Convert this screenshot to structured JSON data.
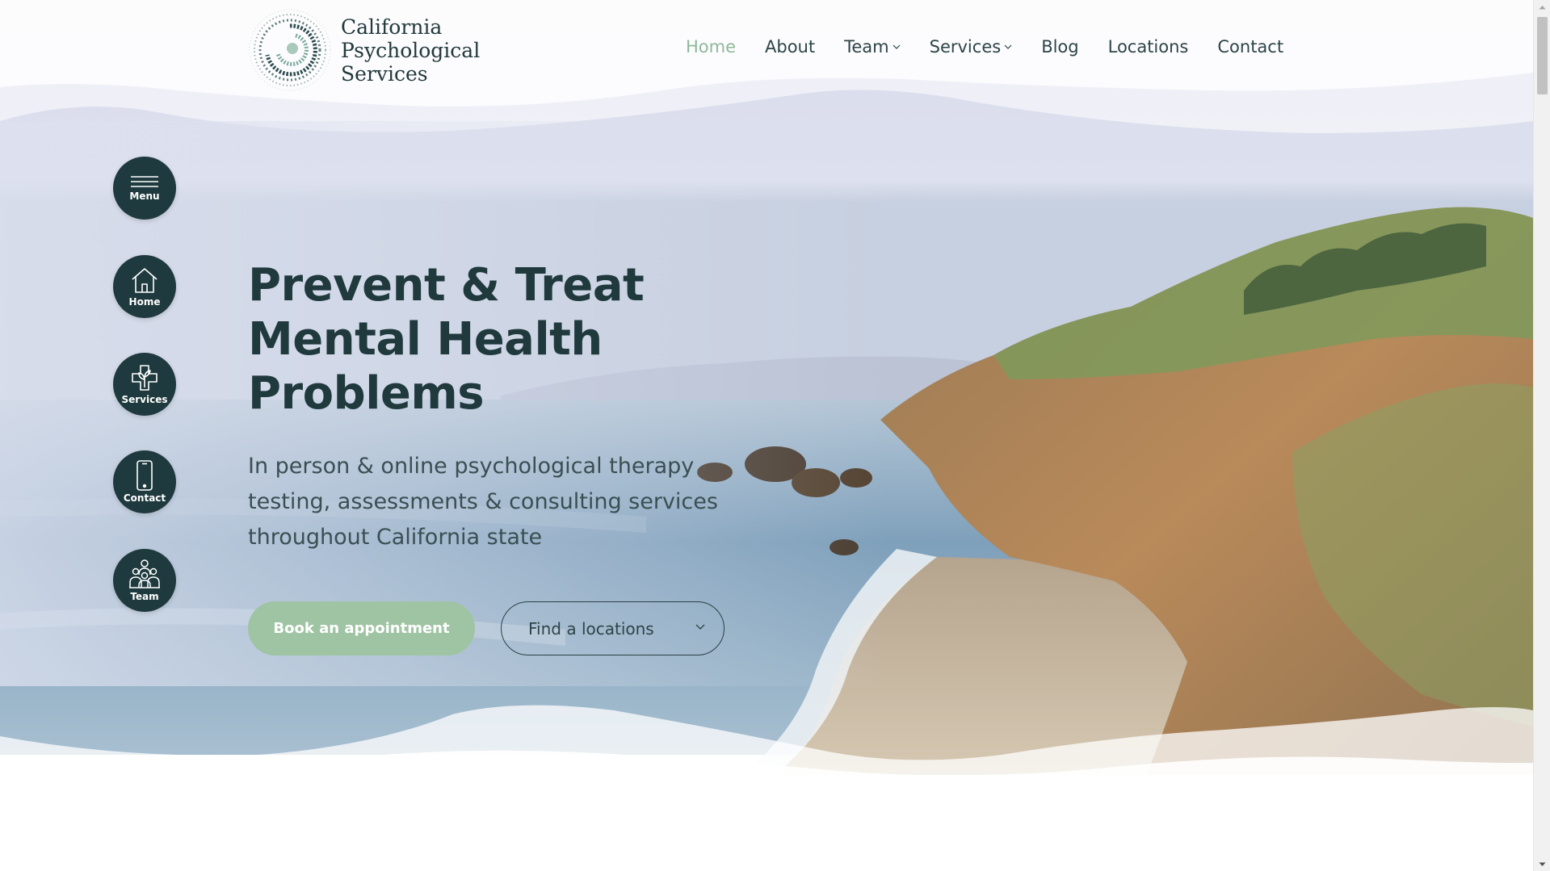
{
  "brand": {
    "name_line1": "California",
    "name_line2": "Psychological",
    "name_line3": "Services",
    "logo_icon": "spiral-dots-logo"
  },
  "nav": {
    "items": [
      {
        "label": "Home",
        "active": true
      },
      {
        "label": "About",
        "active": false
      },
      {
        "label": "Team",
        "dropdown": true
      },
      {
        "label": "Services",
        "dropdown": true
      },
      {
        "label": "Blog",
        "active": false
      },
      {
        "label": "Locations",
        "active": false
      },
      {
        "label": "Contact",
        "active": false
      }
    ]
  },
  "side_nav": {
    "items": [
      {
        "label": "Menu",
        "icon": "hamburger-icon"
      },
      {
        "label": "Home",
        "icon": "house-icon"
      },
      {
        "label": "Services",
        "icon": "medical-cross-plant-icon"
      },
      {
        "label": "Contact",
        "icon": "phone-icon"
      },
      {
        "label": "Team",
        "icon": "people-group-icon"
      }
    ]
  },
  "hero": {
    "title_line1": "Prevent & Treat",
    "title_line2": "Mental Health",
    "title_line3": "Problems",
    "subtitle": "In person & online psychological therapy testing, assessments & consulting services throughout California state",
    "primary_button": "Book an appointment",
    "secondary_button": "Find a locations"
  },
  "colors": {
    "primary_dark": "#1f3a3e",
    "accent_green": "#9fc4a3",
    "nav_active": "#8fb899"
  }
}
